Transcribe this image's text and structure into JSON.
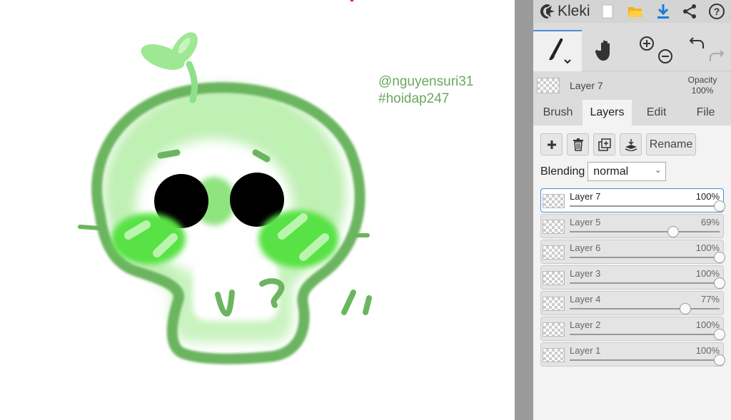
{
  "app": {
    "name": "Kleki"
  },
  "canvas": {
    "watermark_lines": [
      "@nguyensuri31",
      "#hoidap247"
    ]
  },
  "toolbar": {
    "icons": [
      "new-image-icon",
      "open-folder-icon",
      "download-icon",
      "share-icon",
      "help-icon"
    ],
    "tools": [
      "brush-tool-icon",
      "hand-tool-icon",
      "zoom-in-icon",
      "zoom-out-icon",
      "undo-icon",
      "redo-icon"
    ]
  },
  "current_layer": {
    "name": "Layer 7",
    "opacity_label": "Opacity",
    "opacity_value": "100%"
  },
  "tabs": [
    {
      "label": "Brush",
      "active": false
    },
    {
      "label": "Layers",
      "active": true
    },
    {
      "label": "Edit",
      "active": false
    },
    {
      "label": "File",
      "active": false
    }
  ],
  "layer_actions": {
    "icons": [
      "add-layer-icon",
      "delete-layer-icon",
      "duplicate-layer-icon",
      "merge-down-icon"
    ],
    "rename_label": "Rename"
  },
  "blending": {
    "label": "Blending",
    "value": "normal"
  },
  "layers": [
    {
      "name": "Layer 7",
      "opacity": "100%",
      "opacity_value": 1.0,
      "selected": true
    },
    {
      "name": "Layer 5",
      "opacity": "69%",
      "opacity_value": 0.69,
      "selected": false
    },
    {
      "name": "Layer 6",
      "opacity": "100%",
      "opacity_value": 1.0,
      "selected": false
    },
    {
      "name": "Layer 3",
      "opacity": "100%",
      "opacity_value": 1.0,
      "selected": false
    },
    {
      "name": "Layer 4",
      "opacity": "77%",
      "opacity_value": 0.77,
      "selected": false
    },
    {
      "name": "Layer 2",
      "opacity": "100%",
      "opacity_value": 1.0,
      "selected": false
    },
    {
      "name": "Layer 1",
      "opacity": "100%",
      "opacity_value": 1.0,
      "selected": false
    }
  ],
  "colors": {
    "accent": "#1a7be0",
    "drawing_green": "#66b85a",
    "watermark": "#6aa860"
  }
}
